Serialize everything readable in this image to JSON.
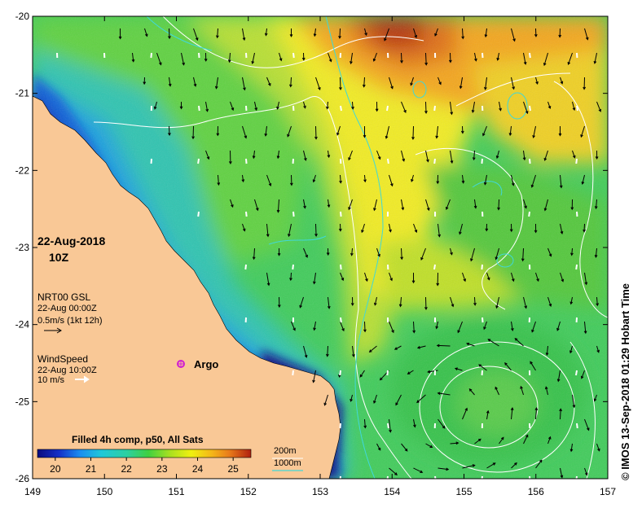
{
  "map": {
    "date": "22-Aug-2018",
    "time": "10Z",
    "lon_ticks": [
      "149",
      "150",
      "151",
      "152",
      "153",
      "154",
      "155",
      "156",
      "157"
    ],
    "lat_ticks": [
      "-20",
      "-21",
      "-22",
      "-23",
      "-24",
      "-25",
      "-26"
    ],
    "current_legend": {
      "title": "NRT00 GSL",
      "time": "22-Aug 00:00Z",
      "scale": "0.5m/s (1kt 12h)"
    },
    "wind_legend": {
      "title": "WindSpeed",
      "time": "22-Aug 10:00Z",
      "scale": "10 m/s"
    },
    "argo_label": "Argo",
    "colorbar": {
      "title": "Filled 4h comp, p50, All Sats",
      "ticks": [
        "20",
        "21",
        "22",
        "23",
        "24",
        "25"
      ],
      "min": 19.5,
      "max": 25.5
    },
    "contours": {
      "c200": "200m",
      "c1000": "1000m"
    },
    "credit": "© IMOS 13-Sep-2018 01:29 Hobart Time",
    "colors": {
      "land": "#f9c896",
      "contour_200": "#ffffff",
      "contour_1000": "#40d8d8",
      "argo": "#d020d0"
    }
  }
}
